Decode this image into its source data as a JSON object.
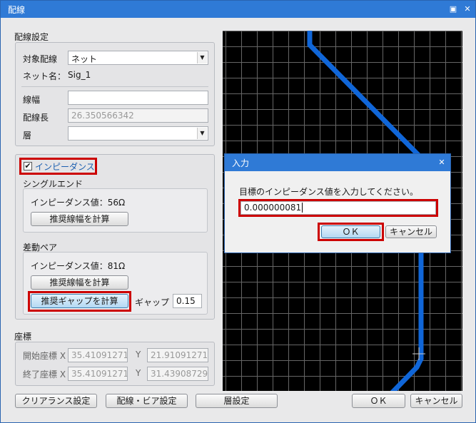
{
  "window": {
    "title": "配線",
    "restore_icon": "restore-icon",
    "close_icon": "close-icon"
  },
  "wiring_settings": {
    "header": "配線設定",
    "target_label": "対象配線",
    "target_value": "ネット",
    "net_name_label": "ネット名：",
    "net_name_value": "Sig_1",
    "width_label": "線幅",
    "width_value": "",
    "length_label": "配線長",
    "length_value": "26.350566342",
    "layer_label": "層",
    "layer_value": ""
  },
  "impedance": {
    "checkbox_label": "インピーダンス",
    "checked": true,
    "single_end": {
      "header": "シングルエンド",
      "value_text": "インピーダンス値：56Ω",
      "calc_width_button": "推奨線幅を計算"
    },
    "diff_pair": {
      "header": "差動ペア",
      "value_text": "インピーダンス値：81Ω",
      "calc_width_button": "推奨線幅を計算",
      "calc_gap_button": "推奨ギャップを計算",
      "gap_label": "ギャップ",
      "gap_value": "0.15"
    }
  },
  "coordinates": {
    "header": "座標",
    "start_label": "開始座標 X",
    "start_x": "35.41091271",
    "start_y_label": "Y",
    "start_y": "21.91091271",
    "end_label": "終了座標 X",
    "end_x": "35.41091271",
    "end_y_label": "Y",
    "end_y": "31.43908729"
  },
  "footer": {
    "clearance_button": "クリアランス設定",
    "via_button": "配線・ビア設定",
    "layer_button": "層設定",
    "ok_button": "ＯＫ",
    "cancel_button": "キャンセル"
  },
  "input_dialog": {
    "title": "入力",
    "prompt": "目標のインピーダンス値を入力してください。",
    "value": "0.000000081",
    "ok_button": "ＯＫ",
    "cancel_button": "キャンセル"
  },
  "colors": {
    "accent": "#2f7ad6",
    "trace": "#1066d8",
    "highlight": "#cc0000"
  }
}
